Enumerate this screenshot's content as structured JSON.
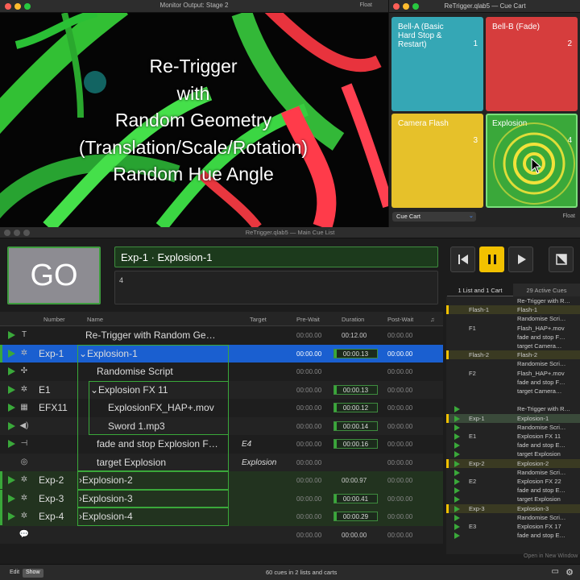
{
  "colors": {
    "accent_green": "#3aa83a",
    "selection_blue": "#1a5fd0",
    "cart_teal": "#35a7b5",
    "cart_red": "#d63d3d",
    "cart_yellow": "#e6c12a",
    "cart_green": "#3aa83a",
    "transport_pause": "#f2c100"
  },
  "monitor": {
    "title": "Monitor Output: Stage 2",
    "float_label": "Float",
    "overlay_lines": [
      "Re-Trigger",
      "with",
      "Random Geometry",
      "(Translation/Scale/Rotation)",
      "Random Hue Angle"
    ]
  },
  "cart": {
    "title": "ReTrigger.qlab5 — Cue Cart",
    "pads": [
      {
        "label": "Bell-A (Basic Hard Stop & Restart)",
        "number": "1"
      },
      {
        "label": "Bell-B (Fade)",
        "number": "2"
      },
      {
        "label": "Camera Flash",
        "number": "3"
      },
      {
        "label": "Explosion",
        "number": "4"
      }
    ],
    "selector": "Cue Cart",
    "float_label": "Float"
  },
  "main": {
    "title": "ReTrigger.qlab5 — Main Cue List",
    "go_label": "GO",
    "cue_name": "Exp-1 · Explosion-1",
    "cue_notes": "4",
    "tabs": [
      "1 List and 1 Cart",
      "29 Active Cues"
    ],
    "columns": [
      "Number",
      "Name",
      "Target",
      "Pre-Wait",
      "Duration",
      "Post-Wait"
    ],
    "rows": [
      {
        "icon": "T",
        "number": "",
        "name": "Re-Trigger with Random Ge…",
        "target": "",
        "prewait": "00:00.00",
        "duration": "00:12.00",
        "postwait": "00:00.00",
        "bar": false,
        "play": true
      },
      {
        "icon": "✲",
        "number": "Exp-1",
        "name": "Explosion-1",
        "target": "",
        "prewait": "00:00.00",
        "duration": "00:00.13",
        "postwait": "00:00.00",
        "bar": true,
        "play": true
      },
      {
        "icon": "✣",
        "number": "",
        "name": "Randomise Script",
        "target": "",
        "prewait": "00:00.00",
        "duration": "",
        "postwait": "00:00.00",
        "bar": false,
        "play": true
      },
      {
        "icon": "✲",
        "number": "E1",
        "name": "Explosion FX 11",
        "target": "",
        "prewait": "00:00.00",
        "duration": "00:00.13",
        "postwait": "00:00.00",
        "bar": true,
        "play": true
      },
      {
        "icon": "▦",
        "number": "EFX11",
        "name": "ExplosionFX_HAP+.mov",
        "target": "",
        "prewait": "00:00.00",
        "duration": "00:00.12",
        "postwait": "00:00.00",
        "bar": true,
        "play": true
      },
      {
        "icon": "◀)",
        "number": "",
        "name": "Sword 1.mp3",
        "target": "",
        "prewait": "00:00.00",
        "duration": "00:00.14",
        "postwait": "00:00.00",
        "bar": true,
        "play": true
      },
      {
        "icon": "⊣",
        "number": "",
        "name": "fade and stop Explosion F…",
        "target": "E4",
        "prewait": "00:00.00",
        "duration": "00:00.16",
        "postwait": "00:00.00",
        "bar": true,
        "play": true
      },
      {
        "icon": "◎",
        "number": "",
        "name": "target Explosion",
        "target": "Explosion",
        "prewait": "00:00.00",
        "duration": "",
        "postwait": "00:00.00",
        "bar": false,
        "play": false
      },
      {
        "icon": "✲",
        "number": "Exp-2",
        "name": "Explosion-2",
        "target": "",
        "prewait": "00:00.00",
        "duration": "00:00.97",
        "postwait": "00:00.00",
        "bar": false,
        "play": true
      },
      {
        "icon": "✲",
        "number": "Exp-3",
        "name": "Explosion-3",
        "target": "",
        "prewait": "00:00.00",
        "duration": "00:00.41",
        "postwait": "00:00.00",
        "bar": true,
        "play": true
      },
      {
        "icon": "✲",
        "number": "Exp-4",
        "name": "Explosion-4",
        "target": "",
        "prewait": "00:00.00",
        "duration": "00:00.29",
        "postwait": "00:00.00",
        "bar": true,
        "play": true
      },
      {
        "icon": "💬",
        "number": "",
        "name": "",
        "target": "",
        "prewait": "00:00.00",
        "duration": "00:00.00",
        "postwait": "00:00.00",
        "bar": false,
        "play": false
      }
    ],
    "side_rows": [
      {
        "a": "",
        "b": "Re-Trigger with R…",
        "hl": false
      },
      {
        "a": "Flash-1",
        "b": "Flash-1",
        "hl": true
      },
      {
        "a": "",
        "b": "Randomise Scri…",
        "hl": false
      },
      {
        "a": "F1",
        "b": "Flash_HAP+.mov",
        "hl": false
      },
      {
        "a": "",
        "b": "fade and stop F…",
        "hl": false
      },
      {
        "a": "",
        "b": "target Camera…",
        "hl": false
      },
      {
        "a": "Flash-2",
        "b": "Flash-2",
        "hl": true
      },
      {
        "a": "",
        "b": "Randomise Scri…",
        "hl": false
      },
      {
        "a": "F2",
        "b": "Flash_HAP+.mov",
        "hl": false
      },
      {
        "a": "",
        "b": "fade and stop F…",
        "hl": false
      },
      {
        "a": "",
        "b": "target Camera…",
        "hl": false
      },
      {
        "a": "",
        "b": "",
        "hl": false
      },
      {
        "a": "",
        "b": "Re-Trigger with R…",
        "hl": false
      },
      {
        "a": "Exp-1",
        "b": "Explosion-1",
        "hl": true
      },
      {
        "a": "",
        "b": "Randomise Scri…",
        "hl": false
      },
      {
        "a": "E1",
        "b": "Explosion FX 11",
        "hl": false
      },
      {
        "a": "",
        "b": "fade and stop E…",
        "hl": false
      },
      {
        "a": "",
        "b": "target Explosion",
        "hl": false
      },
      {
        "a": "Exp-2",
        "b": "Explosion-2",
        "hl": true
      },
      {
        "a": "",
        "b": "Randomise Scri…",
        "hl": false
      },
      {
        "a": "E2",
        "b": "Explosion FX 22",
        "hl": false
      },
      {
        "a": "",
        "b": "fade and stop E…",
        "hl": false
      },
      {
        "a": "",
        "b": "target Explosion",
        "hl": false
      },
      {
        "a": "Exp-3",
        "b": "Explosion-3",
        "hl": true
      },
      {
        "a": "",
        "b": "Randomise Scri…",
        "hl": false
      },
      {
        "a": "E3",
        "b": "Explosion FX 17",
        "hl": false
      },
      {
        "a": "",
        "b": "fade and stop E…",
        "hl": false
      }
    ],
    "footer": {
      "edit": "Edit",
      "show": "Show",
      "status": "60 cues in 2 lists and carts",
      "open_window": "Open in New Window"
    }
  }
}
